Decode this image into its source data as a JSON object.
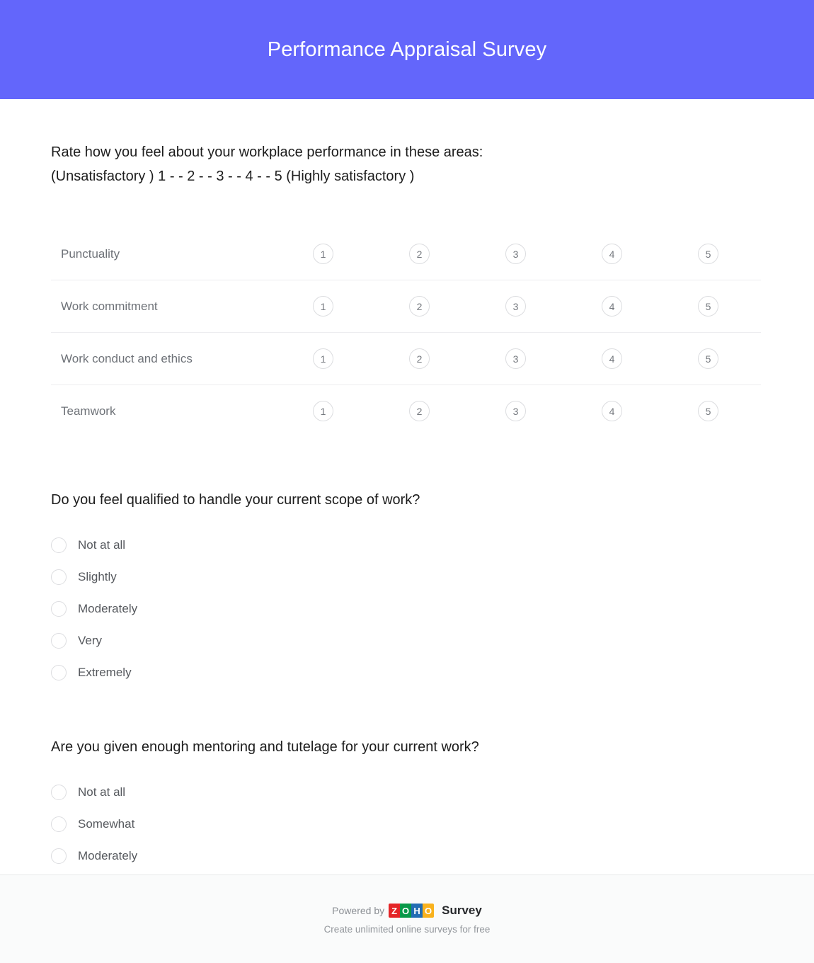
{
  "header": {
    "title": "Performance Appraisal Survey",
    "background_color": "#6366fb",
    "title_color": "#ffffff"
  },
  "questions": [
    {
      "id": "q1",
      "type": "rating-matrix",
      "text": "Rate how you feel about your workplace performance in these areas:",
      "scale_legend": "(Unsatisfactory ) 1 - - 2 - - 3 - - 4 - - 5 (Highly satisfactory )",
      "scale_values": [
        "1",
        "2",
        "3",
        "4",
        "5"
      ],
      "rows": [
        {
          "label": "Punctuality"
        },
        {
          "label": "Work commitment"
        },
        {
          "label": "Work conduct and ethics"
        },
        {
          "label": "Teamwork"
        }
      ]
    },
    {
      "id": "q2",
      "type": "radio",
      "text": "Do you feel qualified to handle your current scope of work?",
      "options": [
        "Not at all",
        "Slightly",
        "Moderately",
        "Very",
        "Extremely"
      ],
      "selected": null
    },
    {
      "id": "q3",
      "type": "radio",
      "text": "Are you given enough mentoring and tutelage for your current work?",
      "options": [
        "Not at all",
        "Somewhat",
        "Moderately"
      ],
      "selected": null
    }
  ],
  "footer": {
    "powered_by": "Powered by",
    "brand_tiles": [
      {
        "letter": "Z",
        "color": "#e42527"
      },
      {
        "letter": "O",
        "color": "#089949"
      },
      {
        "letter": "H",
        "color": "#226db4"
      },
      {
        "letter": "O",
        "color": "#f9b21d"
      }
    ],
    "product": "Survey",
    "tagline": "Create unlimited online surveys for free"
  }
}
